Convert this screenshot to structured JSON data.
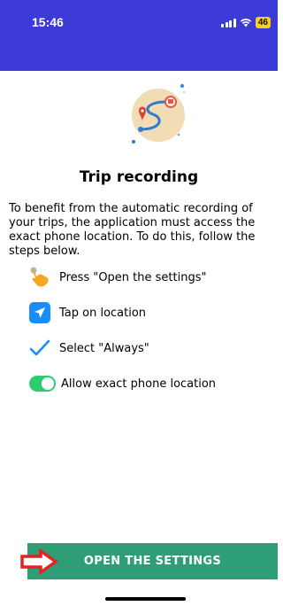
{
  "status_bar": {
    "time": "15:46",
    "battery": "46",
    "icons": [
      "signal-icon",
      "wifi-icon",
      "battery-icon"
    ]
  },
  "colors": {
    "header": "#3d3bd8",
    "accent_green": "#2e9e77",
    "toggle_green": "#2ecc71",
    "location_blue": "#1a8cff",
    "arrow_red": "#e52222"
  },
  "page": {
    "title": "Trip recording",
    "intro": "To benefit from the automatic recording of your trips, the application must access the exact phone location. To do this, follow the steps below.",
    "steps": [
      {
        "icon": "pointing-hand-icon",
        "label": "Press \"Open the settings\""
      },
      {
        "icon": "location-arrow-icon",
        "label": "Tap on location"
      },
      {
        "icon": "checkmark-icon",
        "label": "Select \"Always\""
      },
      {
        "icon": "toggle-on-icon",
        "label": "Allow exact phone location"
      }
    ]
  },
  "cta": {
    "label": "OPEN THE SETTINGS",
    "hint_icon": "red-arrow-icon"
  }
}
